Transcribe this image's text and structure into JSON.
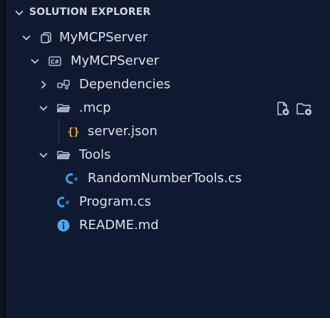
{
  "panel": {
    "title": "SOLUTION EXPLORER"
  },
  "tree": {
    "solution": {
      "label": "MyMCPServer",
      "icon": "solution-icon"
    },
    "project": {
      "label": "MyMCPServer",
      "icon": "csharp-project-icon"
    },
    "dependencies": {
      "label": "Dependencies",
      "icon": "dependencies-icon"
    },
    "mcp_folder": {
      "label": ".mcp",
      "icon": "folder-open-icon"
    },
    "server_json": {
      "label": "server.json",
      "icon": "json-icon"
    },
    "tools_folder": {
      "label": "Tools",
      "icon": "folder-open-icon"
    },
    "random_tools": {
      "label": "RandomNumberTools.cs",
      "icon": "csharp-file-icon"
    },
    "program": {
      "label": "Program.cs",
      "icon": "csharp-file-icon"
    },
    "readme": {
      "label": "README.md",
      "icon": "info-icon"
    }
  },
  "actions": {
    "new_file_icon": "new-file-icon",
    "new_folder_icon": "new-folder-icon"
  },
  "colors": {
    "background": "#0f1a30",
    "text": "#dde3ee",
    "csharp_accent": "#3f9ff0",
    "json_accent": "#e8b43c",
    "info_accent": "#4ea8f0"
  }
}
